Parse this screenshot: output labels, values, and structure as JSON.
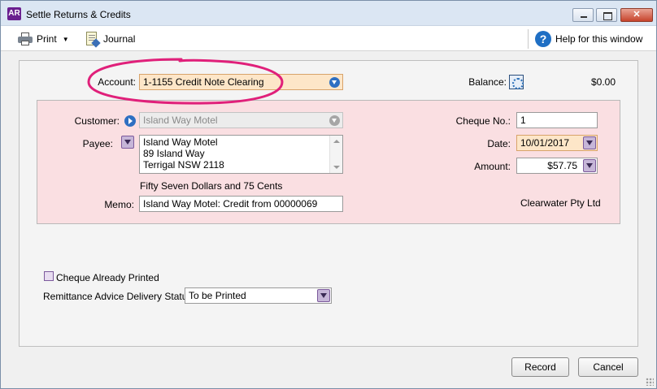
{
  "window": {
    "app_badge": "AR",
    "title": "Settle Returns & Credits",
    "close_glyph": "✕"
  },
  "toolbar": {
    "print_label": "Print",
    "journal_label": "Journal",
    "help_label": "Help for this window",
    "help_glyph": "?",
    "caret_glyph": "▼"
  },
  "account": {
    "label": "Account:",
    "value": "1-1155 Credit Note Clearing"
  },
  "balance": {
    "label": "Balance:",
    "value": "$0.00"
  },
  "customer": {
    "label": "Customer:",
    "value": "Island Way Motel"
  },
  "payee": {
    "label": "Payee:",
    "lines": [
      "Island Way Motel",
      "89 Island Way",
      "Terrigal  NSW  2118"
    ]
  },
  "amount_in_words": "Fifty Seven Dollars and 75 Cents",
  "memo": {
    "label": "Memo:",
    "value": "Island Way Motel: Credit from 00000069"
  },
  "cheque_no": {
    "label": "Cheque No.:",
    "value": "1"
  },
  "date": {
    "label": "Date:",
    "value": "10/01/2017"
  },
  "amount": {
    "label": "Amount:",
    "value": "$57.75"
  },
  "company_name": "Clearwater Pty Ltd",
  "cheque_printed": {
    "label": "Cheque Already Printed",
    "checked": false
  },
  "remittance": {
    "label": "Remittance Advice Delivery Status:",
    "value": "To be Printed"
  },
  "buttons": {
    "record": "Record",
    "cancel": "Cancel"
  },
  "colors": {
    "annotation": "#e0207a",
    "panel_pink": "#fadfe2",
    "highlight_field": "#fde6c8",
    "accent_blue": "#2e6fc2"
  }
}
